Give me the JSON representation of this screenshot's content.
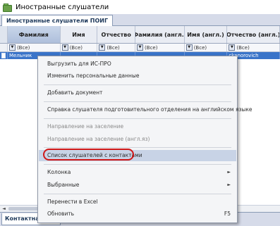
{
  "window": {
    "title": "Иностранные слушатели"
  },
  "tabs": {
    "main": "Иностранные слушатели ПОИГ"
  },
  "grid": {
    "columns": [
      "Фамилия",
      "Имя",
      "Отчество",
      "Фамилия (англ.)",
      "Имя (англ.)",
      "Отчество (англ.)"
    ],
    "filter_value": "(Все)",
    "row": [
      "Мельник",
      "",
      "",
      "",
      "",
      "ckanorovich"
    ]
  },
  "context_menu": {
    "items": [
      {
        "label": "Выгрузить для ИС-ПРО",
        "disabled": false
      },
      {
        "label": "Изменить персональные данные",
        "disabled": false
      },
      {
        "label": "Добавить документ",
        "disabled": false
      },
      {
        "label": "Справка слушателя подготовительного отделения на английском языке",
        "disabled": false
      },
      {
        "label": "Направление на заселение",
        "disabled": true
      },
      {
        "label": "Направление на заселение (англ.яз)",
        "disabled": true
      },
      {
        "label": "Список слушателей с контактами",
        "disabled": false,
        "highlighted": true
      },
      {
        "label": "Колонка",
        "disabled": false,
        "submenu": true
      },
      {
        "label": "Выбранные",
        "disabled": false,
        "submenu": true
      },
      {
        "label": "Перенести в Excel",
        "disabled": false
      },
      {
        "label": "Обновить",
        "disabled": false,
        "shortcut": "F5"
      }
    ]
  },
  "bottom_tabs": {
    "active": "Контактная",
    "other": ""
  },
  "colors": {
    "selection": "#3a74c9",
    "highlight_ring": "#d01818",
    "menu_hover": "#c8d3e6"
  },
  "icons": {
    "app": "folder-icon",
    "submenu": "submenu-arrow-icon",
    "filter": "filter-dropdown-icon"
  }
}
